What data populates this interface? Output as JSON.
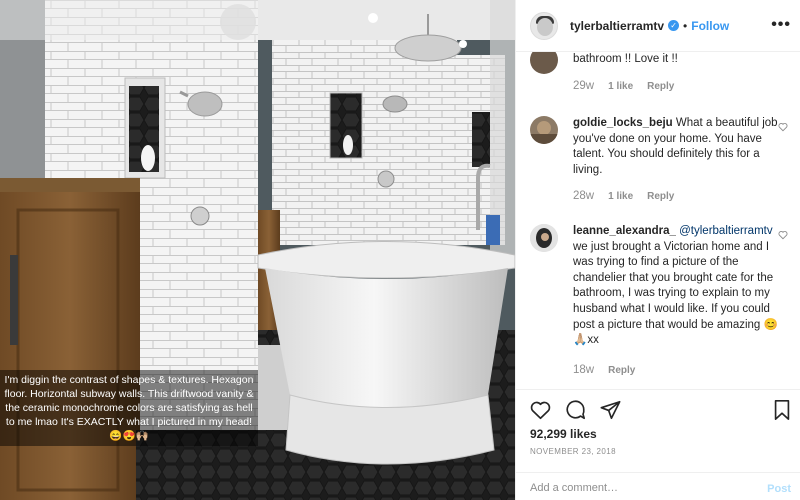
{
  "photo": {
    "caption": "I'm diggin the contrast of shapes & textures. Hexagon floor. Horizontal subway walls. This driftwood vanity & the ceramic monochrome colors are satisfying as hell to me lmao It's EXACTLY what I pictured in my head! 😄😍🙌🏼"
  },
  "header": {
    "username": "tylerbaltierramtv",
    "verified_glyph": "✓",
    "separator": "•",
    "follow_label": "Follow",
    "more_glyph": "•••"
  },
  "comments": [
    {
      "text": "bathroom !! Love it !!",
      "time": "29w",
      "likes": "1 like",
      "reply": "Reply"
    },
    {
      "user": "goldie_locks_beju",
      "text": "What a beautiful job you've done on your home. You have talent. You should definitely this for a living.",
      "time": "28w",
      "likes": "1 like",
      "reply": "Reply"
    },
    {
      "user": "leanne_alexandra_",
      "mention": "@tylerbaltierramtv",
      "text": "we just brought a Victorian home and I was trying to find a picture of the chandelier that you brought cate for the bathroom, I was trying to explain to my husband what I would like. If you could post a picture that would be amazing 😊🙏🏼xx",
      "time": "18w",
      "reply": "Reply"
    }
  ],
  "post": {
    "likes": "92,299 likes",
    "date": "NOVEMBER 23, 2018",
    "comment_placeholder": "Add a comment…",
    "post_label": "Post"
  },
  "colors": {
    "accent": "#3897f0",
    "text": "#262626",
    "muted": "#8e8e8e",
    "border": "#efefef"
  },
  "icons": [
    "heart-icon",
    "comment-icon",
    "share-icon",
    "bookmark-icon",
    "verified-icon",
    "more-icon"
  ]
}
